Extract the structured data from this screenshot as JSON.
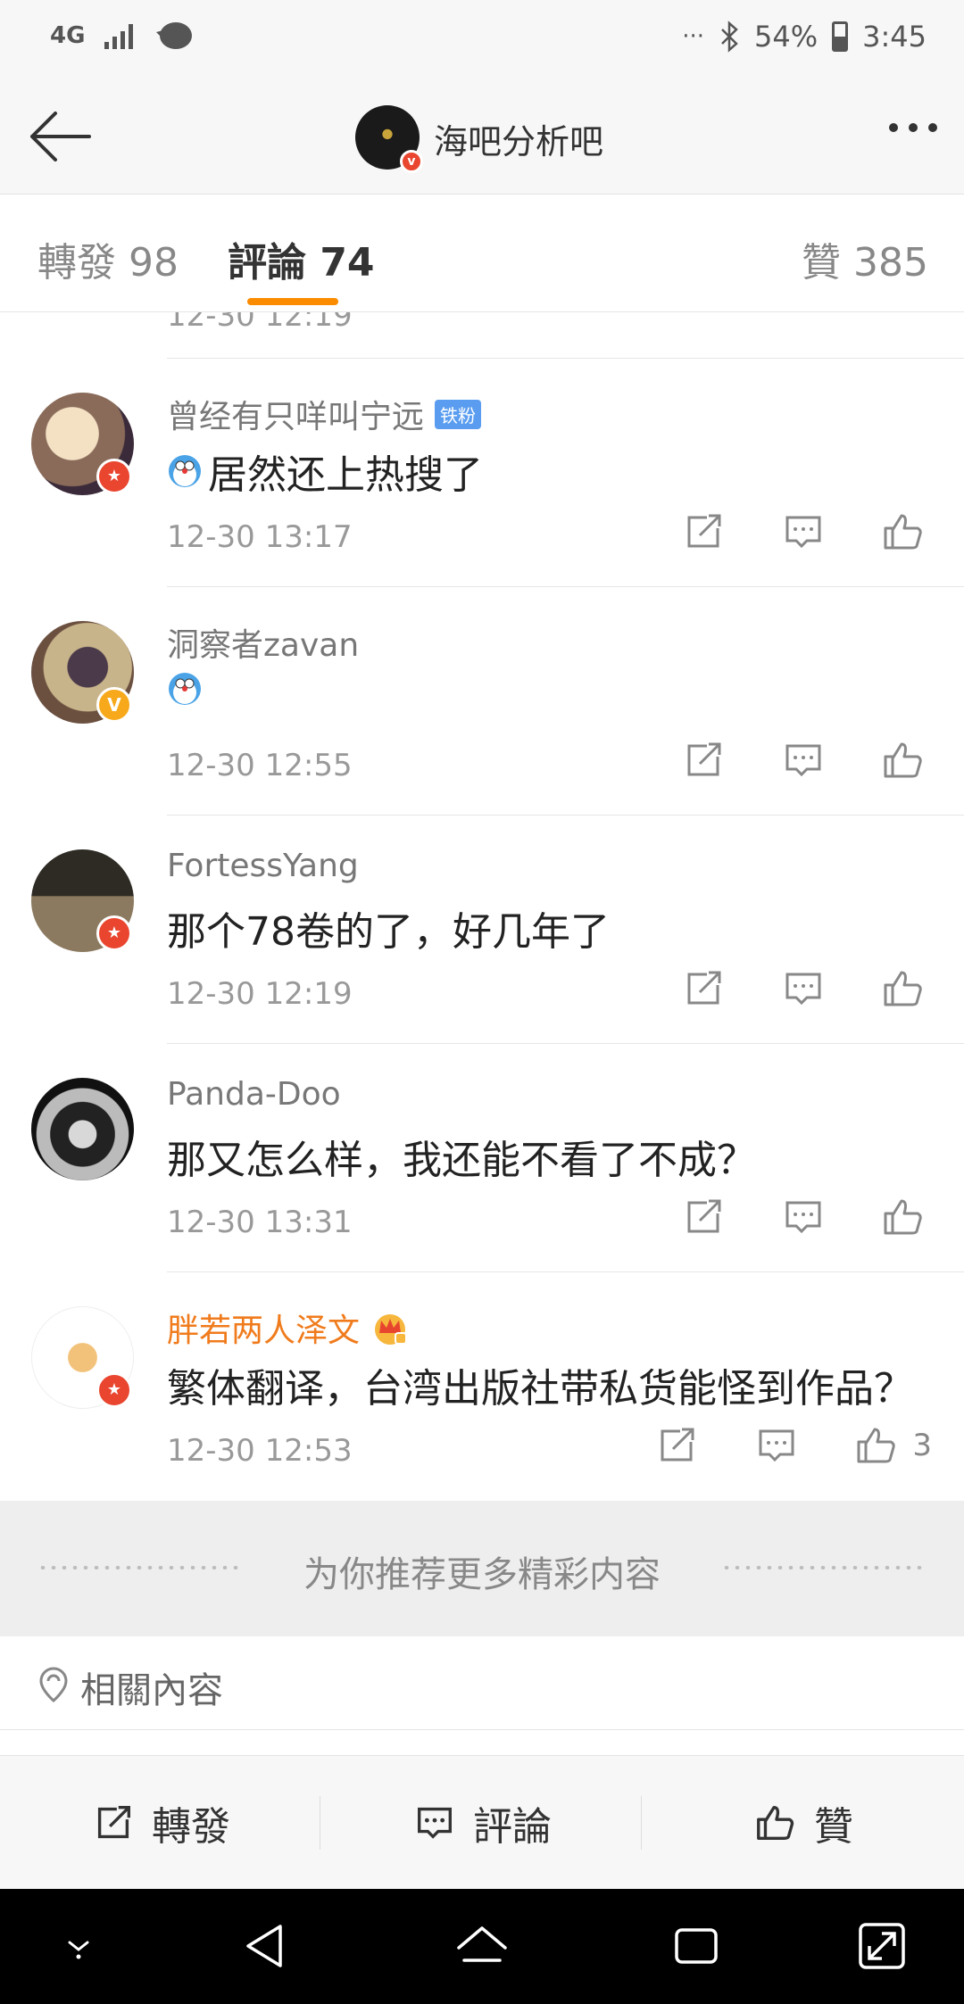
{
  "status_bar": {
    "network": "4G",
    "battery": "54%",
    "time": "3:45",
    "dots": "···"
  },
  "header": {
    "title": "海吧分析吧"
  },
  "tabs": {
    "repost": "轉發 98",
    "comments": "評論 74",
    "likes": "贊 385"
  },
  "partial_row": {
    "time": "12-30 12:19"
  },
  "comments": [
    {
      "user": "曾经有只咩叫宁远",
      "badge": "铁粉",
      "emoji": "doraemon-emoji",
      "text": "居然还上热搜了",
      "time": "12-30 13:17",
      "likes": ""
    },
    {
      "user": "洞察者zavan",
      "badge": "",
      "emoji": "doraemon-emoji",
      "text": "",
      "time": "12-30 12:55",
      "likes": ""
    },
    {
      "user": "FortessYang",
      "badge": "",
      "emoji": "",
      "text": "那个78卷的了，好几年了",
      "time": "12-30 12:19",
      "likes": ""
    },
    {
      "user": "Panda-Doo",
      "badge": "",
      "emoji": "",
      "text": "那又怎么样，我还能不看了不成？",
      "time": "12-30 13:31",
      "likes": ""
    },
    {
      "user": "胖若两人泽文",
      "badge": "",
      "emoji": "",
      "text": "繁体翻译，台湾出版社带私货能怪到作品？",
      "time": "12-30 12:53",
      "likes": "3"
    }
  ],
  "recommend": {
    "text": "为你推荐更多精彩内容"
  },
  "related": {
    "text": "相關內容"
  },
  "bottom_bar": {
    "repost": "轉發",
    "comment": "評論",
    "like": "贊"
  },
  "colors": {
    "accent": "#fb8c00",
    "vip_name": "#f07b1c",
    "fan_badge": "#5a9df0",
    "verified_red": "#e9452f",
    "verified_yellow": "#f7a91b"
  }
}
